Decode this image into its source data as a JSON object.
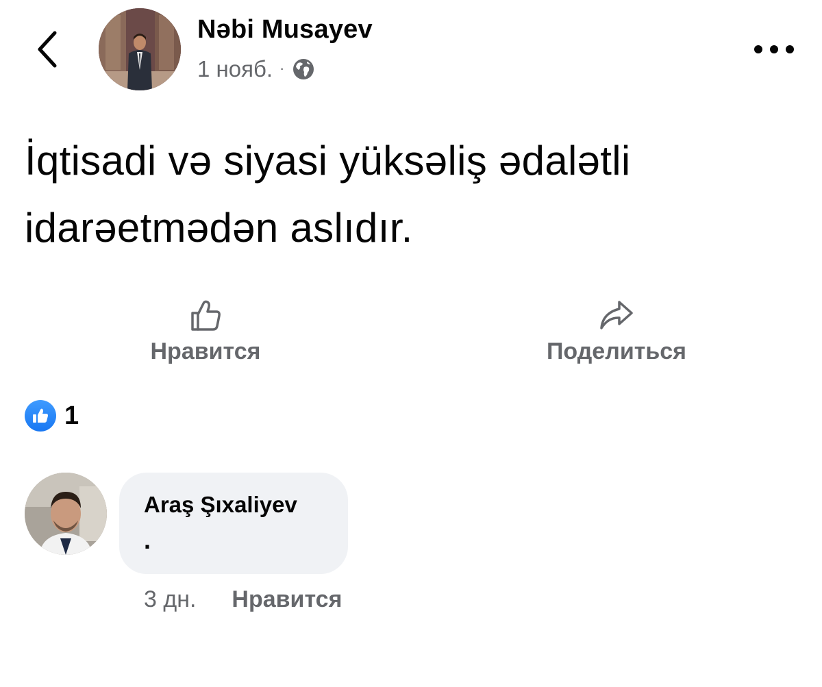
{
  "header": {
    "author_name": "Nəbi Musayev",
    "date": "1 нояб.",
    "separator": "·",
    "audience_icon": "globe-icon",
    "back_icon": "chevron-left-icon",
    "more_icon": "more-horizontal-icon"
  },
  "post": {
    "text": "İqtisadi və siyasi yüksəliş ədalətli idarəetmədən aslıdır."
  },
  "actions": {
    "like_label": "Нравится",
    "like_icon": "thumbs-up-outline-icon",
    "share_label": "Поделиться",
    "share_icon": "share-arrow-icon"
  },
  "reactions": {
    "icon": "like-reaction-icon",
    "count": "1"
  },
  "comment": {
    "author_name": "Araş Şıxaliyev",
    "text": ".",
    "time": "3 дн.",
    "like_label": "Нравится"
  },
  "colors": {
    "text_primary": "#050505",
    "text_secondary": "#65676b",
    "bubble_bg": "#f0f2f5",
    "like_blue": "#1877f2"
  }
}
